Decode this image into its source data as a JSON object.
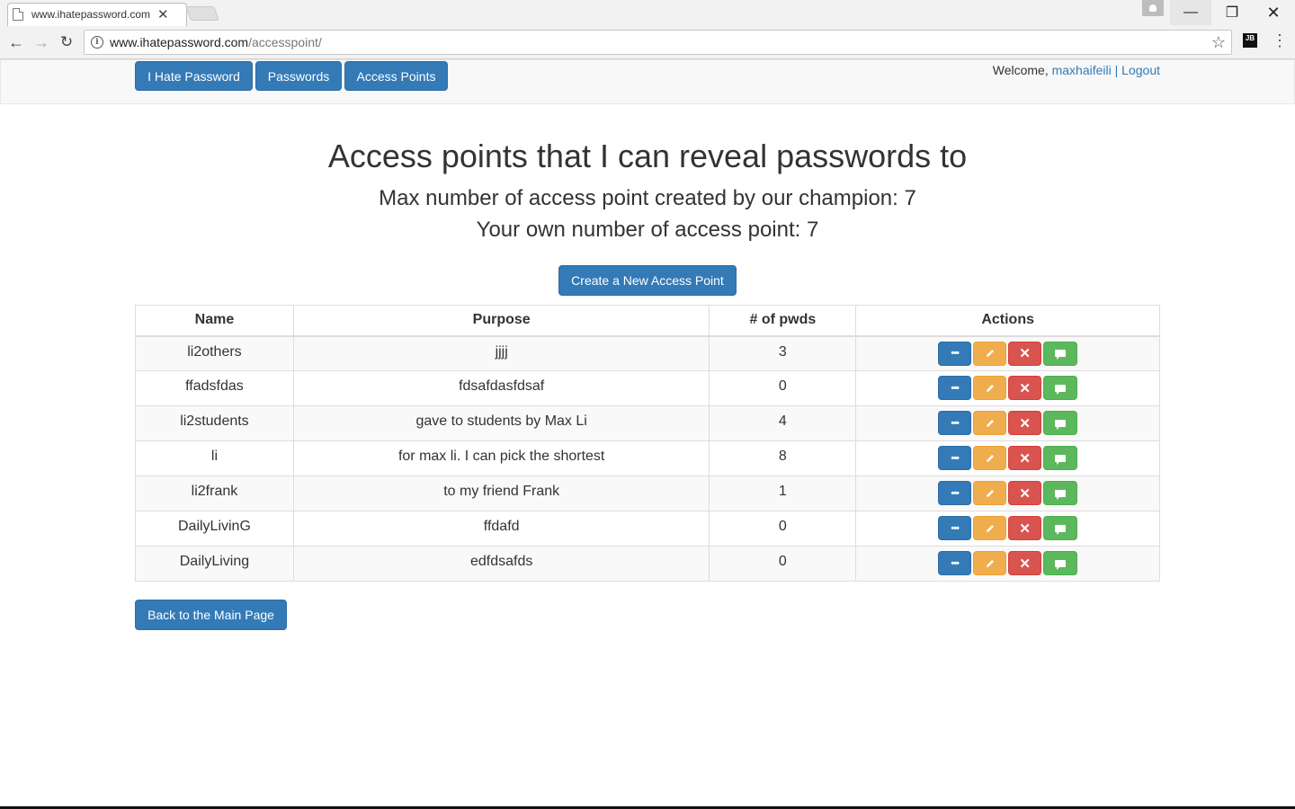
{
  "browser": {
    "tab_title": "www.ihatepassword.com",
    "url_host": "www.ihatepassword.com",
    "url_path": "/accesspoint/",
    "tab_close": "✕",
    "min": "—",
    "max": "❐",
    "close": "✕"
  },
  "navbar": {
    "brand": "I Hate Password",
    "passwords": "Passwords",
    "access_points": "Access Points",
    "welcome": "Welcome,",
    "username": "maxhaifeili",
    "separator": "|",
    "logout": "Logout"
  },
  "heading": {
    "title": "Access points that I can reveal passwords to",
    "max_line": "Max number of access point created by our champion: 7",
    "own_line": "Your own number of access point: 7"
  },
  "create_button": "Create a New Access Point",
  "table": {
    "headers": [
      "Name",
      "Purpose",
      "# of pwds",
      "Actions"
    ],
    "rows": [
      {
        "name": "li2others",
        "purpose": "jjjj",
        "pwds": "3"
      },
      {
        "name": "ffadsfdas",
        "purpose": "fdsafdasfdsaf",
        "pwds": "0"
      },
      {
        "name": "li2students",
        "purpose": "gave to students by Max Li",
        "pwds": "4"
      },
      {
        "name": "li",
        "purpose": "for max li. I can pick the shortest",
        "pwds": "8"
      },
      {
        "name": "li2frank",
        "purpose": "to my friend Frank",
        "pwds": "1"
      },
      {
        "name": "DailyLivinG",
        "purpose": "ffdafd",
        "pwds": "0"
      },
      {
        "name": "DailyLiving",
        "purpose": "edfdsafds",
        "pwds": "0"
      }
    ]
  },
  "back_button": "Back to the Main Page",
  "colors": {
    "primary": "#337ab7",
    "warning": "#f0ad4e",
    "danger": "#d9534f",
    "success": "#5cb85c"
  },
  "icons": {
    "info": "ellipsis-icon",
    "edit": "pencil-icon",
    "delete": "x-icon",
    "message": "comment-icon"
  }
}
